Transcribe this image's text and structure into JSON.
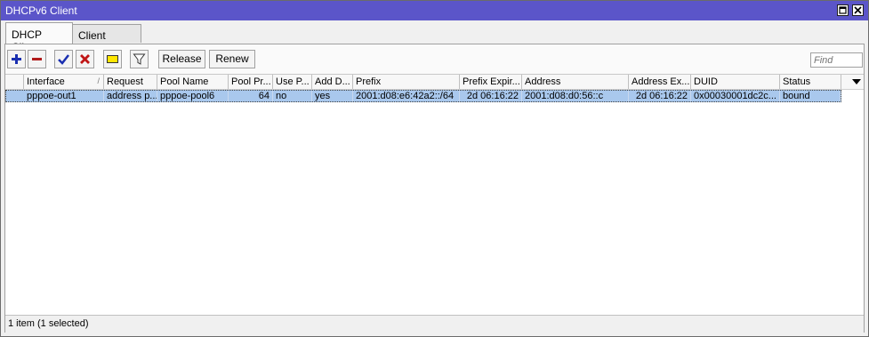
{
  "window": {
    "title": "DHCPv6 Client"
  },
  "tabs": [
    {
      "label": "DHCP Client",
      "active": true
    },
    {
      "label": "Client Options",
      "active": false
    }
  ],
  "toolbar": {
    "icons": [
      "add-icon",
      "remove-icon",
      "enable-icon",
      "disable-icon",
      "comment-icon",
      "filter-icon"
    ],
    "release_label": "Release",
    "renew_label": "Renew",
    "find_placeholder": "Find"
  },
  "table": {
    "columns": [
      "Interface",
      "Request",
      "Pool Name",
      "Pool Pr...",
      "Use P...",
      "Add D...",
      "Prefix",
      "Prefix Expir...",
      "Address",
      "Address Ex...",
      "DUID",
      "Status"
    ],
    "rows": [
      {
        "interface": "pppoe-out1",
        "request": "address p...",
        "pool_name": "pppoe-pool6",
        "pool_prefix": "64",
        "use_peer": "no",
        "add_default": "yes",
        "prefix": "2001:d08:e6:42a2::/64",
        "prefix_expires": "2d 06:16:22",
        "address": "2001:d08:d0:56::c",
        "address_expires": "2d 06:16:22",
        "duid": "0x00030001dc2c...",
        "status": "bound",
        "selected": true
      }
    ]
  },
  "status": {
    "text": "1 item (1 selected)"
  },
  "colors": {
    "titlebar": "#5b55c9",
    "selected_row": "#a9c8ed"
  }
}
